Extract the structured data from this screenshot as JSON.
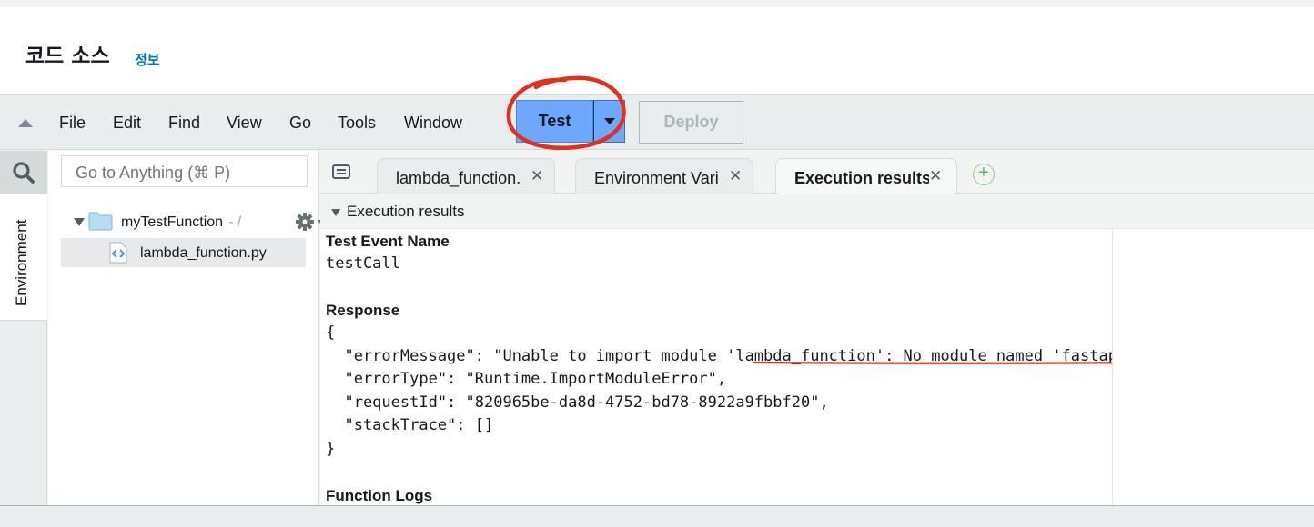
{
  "header": {
    "title": "코드 소스",
    "info_link": "정보"
  },
  "menubar": {
    "items": [
      "File",
      "Edit",
      "Find",
      "View",
      "Go",
      "Tools",
      "Window"
    ],
    "test_label": "Test",
    "deploy_label": "Deploy"
  },
  "left_rail": {
    "environment_label": "Environment"
  },
  "file_panel": {
    "search_placeholder": "Go to Anything (⌘ P)",
    "root_folder": "myTestFunction",
    "root_path": "- /",
    "file": "lambda_function.py"
  },
  "tabs": [
    {
      "label": "lambda_function.",
      "active": false
    },
    {
      "label": "Environment Vari",
      "active": false
    },
    {
      "label": "Execution results",
      "active": true
    }
  ],
  "results": {
    "header": "Execution results",
    "test_event_label": "Test Event Name",
    "test_event_value": "testCall",
    "response_label": "Response",
    "response_lines": [
      "{",
      "  \"errorMessage\": \"Unable to import module 'lambda_function': No module named 'fastapi'\",",
      "  \"errorType\": \"Runtime.ImportModuleError\",",
      "  \"requestId\": \"820965be-da8d-4752-bd78-8922a9fbbf20\",",
      "  \"stackTrace\": []",
      "}"
    ],
    "function_logs_label": "Function Logs"
  },
  "colors": {
    "test_button": "#6ea8fe",
    "annotation": "#e0301e",
    "link": "#0073bb"
  }
}
